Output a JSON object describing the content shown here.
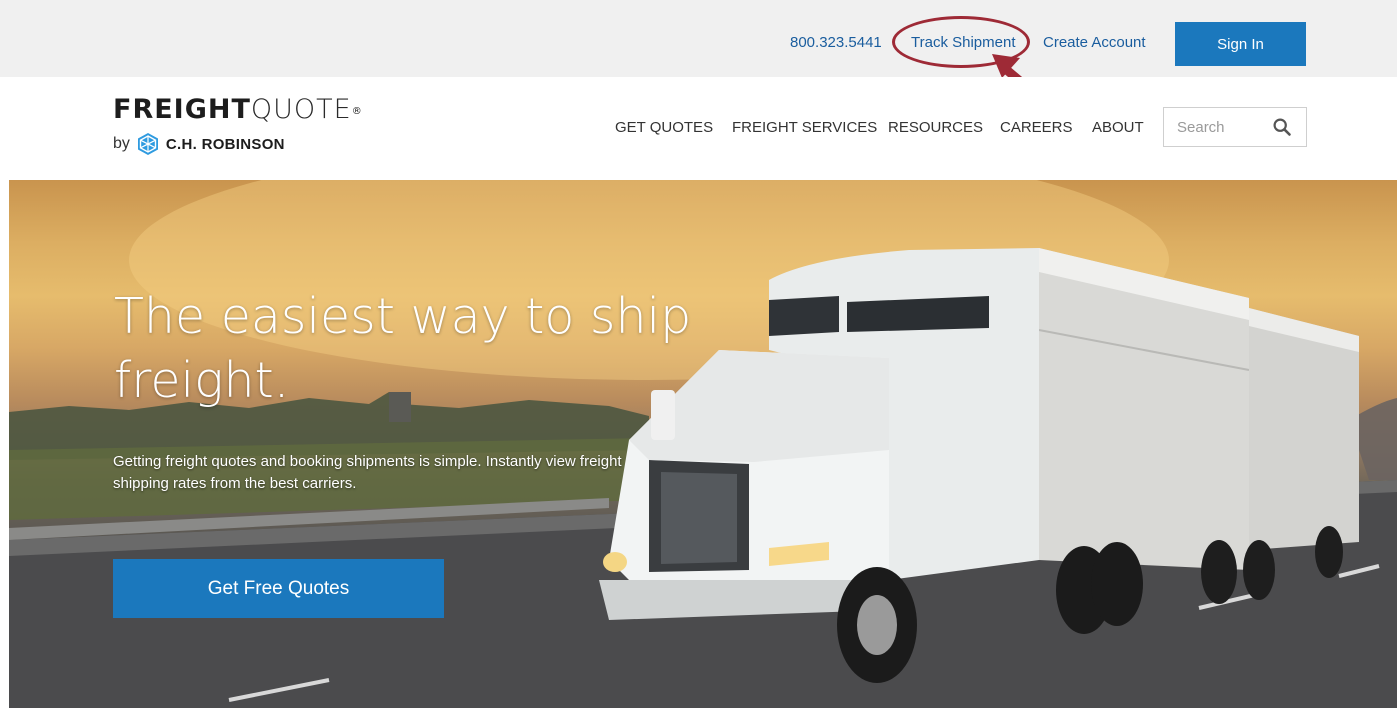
{
  "utility": {
    "phone": "800.323.5441",
    "track_shipment": "Track Shipment",
    "create_account": "Create Account",
    "sign_in": "Sign In"
  },
  "logo": {
    "word_bold": "FREIGHT",
    "word_light": "QUOTE",
    "registered": "®",
    "by": "by",
    "parent": "C.H. ROBINSON"
  },
  "nav": {
    "items": [
      "GET QUOTES",
      "FREIGHT SERVICES",
      "RESOURCES",
      "CAREERS",
      "ABOUT"
    ],
    "search_placeholder": "Search"
  },
  "hero": {
    "title": "The easiest way to ship freight.",
    "subtitle": "Getting freight quotes and booking shipments is simple. Instantly view freight shipping rates from the best carriers.",
    "cta": "Get Free Quotes"
  },
  "icons": {
    "search": "search-icon",
    "logo_mark": "chr-hexagon-icon",
    "annotation": "red-arrow-icon"
  },
  "colors": {
    "brand_blue": "#1b78bd",
    "link_blue": "#1a5d9e",
    "annotation_red": "#9e2a36",
    "utility_bg": "#f0f0f0"
  }
}
